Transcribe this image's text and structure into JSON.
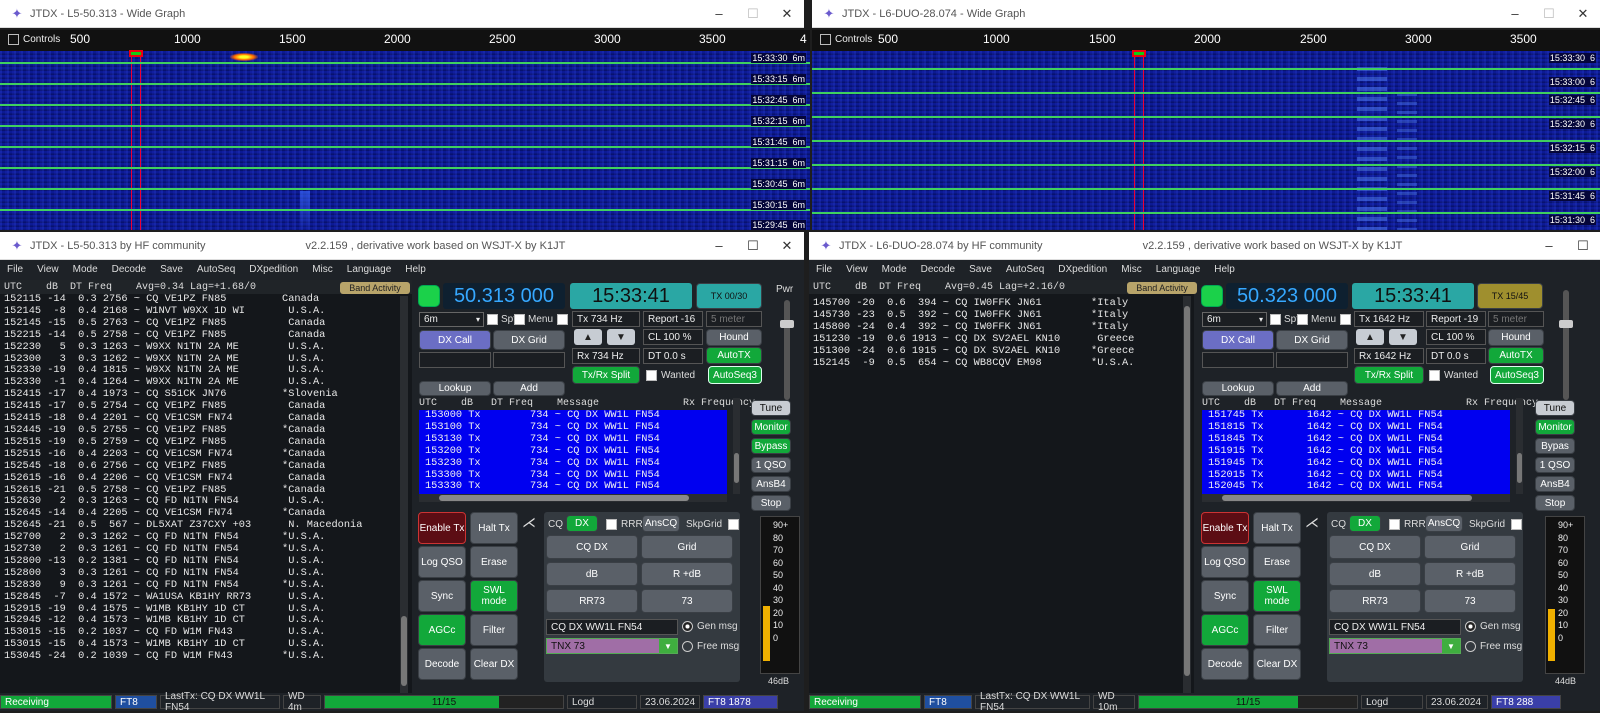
{
  "left_graph": {
    "title": "JTDX - L5-50.313 - Wide Graph",
    "controls_label": "Controls",
    "ticks": [
      "500",
      "1000",
      "1500",
      "2000",
      "2500",
      "3000",
      "3500",
      "4"
    ],
    "times": [
      "15:33:30",
      "15:33:15",
      "15:32:45",
      "15:32:15",
      "15:31:45",
      "15:31:15",
      "15:30:45",
      "15:30:15",
      "15:29:45"
    ],
    "band": "6m"
  },
  "right_graph": {
    "title": "JTDX - L6-DUO-28.074 - Wide Graph",
    "controls_label": "Controls",
    "ticks": [
      "500",
      "1000",
      "1500",
      "2000",
      "2500",
      "3000",
      "3500"
    ],
    "times": [
      "15:33:30",
      "15:33:00",
      "15:32:45",
      "15:32:30",
      "15:32:15",
      "15:32:00",
      "15:31:45",
      "15:31:30"
    ],
    "band": "6"
  },
  "left": {
    "title": "JTDX - L5-50.313  by HF community",
    "version": "v2.2.159 , derivative work based on WSJT-X by K1JT",
    "menu": [
      "File",
      "View",
      "Mode",
      "Decode",
      "Save",
      "AutoSeq",
      "DXpedition",
      "Misc",
      "Language",
      "Help"
    ],
    "decode_header": "UTC    dB  DT Freq    Avg=0.34 Lag=+1.68/0",
    "band_activity": "Band Activity",
    "decodes": "152115 -14  0.3 2756 ~ CQ VE1PZ FN85         Canada\n152145  -8  0.4 2168 ~ W1NVT W9XX 1D WI       U.S.A.\n152145 -15  0.5 2763 ~ CQ VE1PZ FN85          Canada\n152215 -14  0.5 2758 ~ CQ VE1PZ FN85          Canada\n152230   5  0.3 1263 ~ W9XX N1TN 2A ME        U.S.A.\n152300   3  0.3 1262 ~ W9XX N1TN 2A ME        U.S.A.\n152330 -19  0.4 1815 ~ W9XX N1TN 2A ME        U.S.A.\n152330  -1  0.4 1264 ~ W9XX N1TN 2A ME        U.S.A.\n152415 -17  0.4 1973 ~ CQ S51CK JN76         *Slovenia\n152415 -17  0.5 2754 ~ CQ VE1PZ FN85          Canada\n152415 -18  0.4 2201 ~ CQ VE1CSM FN74         Canada\n152445 -19  0.5 2755 ~ CQ VE1PZ FN85         *Canada\n152515 -19  0.5 2759 ~ CQ VE1PZ FN85          Canada\n152515 -16  0.4 2203 ~ CQ VE1CSM FN74        *Canada\n152545 -18  0.6 2756 ~ CQ VE1PZ FN85         *Canada\n152615 -16  0.4 2206 ~ CQ VE1CSM FN74         Canada\n152615 -21  0.5 2758 ~ CQ VE1PZ FN85         *Canada\n152630   2  0.3 1263 ~ CQ FD N1TN FN54        U.S.A.\n152645 -14  0.4 2205 ~ CQ VE1CSM FN74        *Canada\n152645 -21  0.5  567 ~ DL5XAT Z37CXY +03      N. Macedonia\n152700   2  0.3 1262 ~ CQ FD N1TN FN54       *U.S.A.\n152730   2  0.3 1261 ~ CQ FD N1TN FN54       *U.S.A.\n152800 -13  0.2 1381 ~ CQ FD N1TN FN54        U.S.A.\n152800   3  0.3 1261 ~ CQ FD N1TN FN54        U.S.A.\n152830   9  0.3 1261 ~ CQ FD N1TN FN54       *U.S.A.\n152845  -7  0.4 1572 ~ WA1USA KB1HY RR73      U.S.A.\n152915 -19  0.4 1575 ~ W1MB KB1HY 1D CT       U.S.A.\n152945 -12  0.4 1573 ~ W1MB KB1HY 1D CT       U.S.A.\n153015 -15  0.2 1037 ~ CQ FD W1M FN43         U.S.A.\n153015 -15  0.4 1573 ~ W1MB KB1HY 1D CT       U.S.A.\n153045 -24  0.2 1039 ~ CQ FD W1M FN43        *U.S.A.",
    "freq": "50.313 000",
    "clock": "15:33:41",
    "tx_counter": "TX 00/30",
    "pwr": "Pwr",
    "band": "6m",
    "spt": "Spt",
    "menu_chk": "Menu",
    "tx_hz": "Tx  734  Hz",
    "rx_hz": "Rx  734  Hz",
    "report": "Report -16",
    "meter": "5 meter",
    "cl": "CL  100 %",
    "dt": "DT 0.0 s",
    "hound": "Hound",
    "autotx": "AutoTX",
    "autoseq": "AutoSeq3",
    "dxcall": "DX Call",
    "dxgrid": "DX Grid",
    "txrxsplit": "Tx/Rx Split",
    "wanted": "Wanted",
    "lookup": "Lookup",
    "add": "Add",
    "tx_header": "UTC    dB   DT Freq    Message              Rx Frequency",
    "tx_rows": "153000 Tx        734 ~ CQ DX WW1L FN54\n153100 Tx        734 ~ CQ DX WW1L FN54\n153130 Tx        734 ~ CQ DX WW1L FN54\n153200 Tx        734 ~ CQ DX WW1L FN54\n153230 Tx        734 ~ CQ DX WW1L FN54\n153300 Tx        734 ~ CQ DX WW1L FN54\n153330 Tx        734 ~ CQ DX WW1L FN54",
    "tune": "Tune",
    "monitor": "Monitor",
    "bypass": "Bypass",
    "oneqso": "1 QSO",
    "ansb4": "AnsB4",
    "stop": "Stop",
    "enabletx": "Enable Tx",
    "halttx": "Halt Tx",
    "logqso": "Log QSO",
    "erase": "Erase",
    "sync": "Sync",
    "swl": "SWL mode",
    "agcc": "AGCc",
    "filter": "Filter",
    "decode": "Decode",
    "cleardx": "Clear DX",
    "cq": "CQ",
    "dx": "DX",
    "rrr": "RRR",
    "anscq": "AnsCQ",
    "skpgrid": "SkpGrid",
    "cqdx": "CQ DX",
    "grid": "Grid",
    "db": "dB",
    "rdb": "R +dB",
    "rr73": "RR73",
    "b73": "73",
    "genmsg_text": "CQ DX WW1L FN54",
    "genmsg": "Gen msg",
    "tnx": "TNX 73",
    "freemsg": "Free msg",
    "meter_scale": [
      "90+",
      "80",
      "70",
      "60",
      "50",
      "40",
      "30",
      "20",
      "10",
      "0"
    ],
    "meter_db": "46dB",
    "meter_level": 0.42,
    "status": {
      "state": "Receiving",
      "mode": "FT8",
      "lasttx": "LastTx: CQ DX WW1L FN54",
      "wd": "WD 4m",
      "progress": "11/15",
      "logd": "Logd",
      "date": "23.06.2024",
      "mode2": "FT8  1878",
      "progress_frac": 0.73
    }
  },
  "right": {
    "title": "JTDX - L6-DUO-28.074  by HF community",
    "version": "v2.2.159 , derivative work based on WSJT-X by K1JT",
    "menu": [
      "File",
      "View",
      "Mode",
      "Decode",
      "Save",
      "AutoSeq",
      "DXpedition",
      "Misc",
      "Language",
      "Help"
    ],
    "decode_header": "UTC    dB  DT Freq    Avg=0.45 Lag=+2.16/0",
    "band_activity": "Band Activity",
    "decodes": "145700 -20  0.6  394 ~ CQ IW0FFK JN61        *Italy\n145730 -23  0.5  392 ~ CQ IW0FFK JN61        *Italy\n145800 -24  0.4  392 ~ CQ IW0FFK JN61        *Italy\n151230 -19  0.6 1913 ~ CQ DX SV2AEL KN10      Greece\n151300 -24  0.6 1915 ~ CQ DX SV2AEL KN10     *Greece\n152145  -9  0.5  654 ~ CQ WB8CQV EM98        *U.S.A.",
    "freq": "50.323 000",
    "clock": "15:33:41",
    "tx_counter": "TX 15/45",
    "band": "6m",
    "spt": "Spt",
    "menu_chk": "Menu",
    "tx_hz": "Tx  1642  Hz",
    "rx_hz": "Rx  1642  Hz",
    "report": "Report -19",
    "meter": "5 meter",
    "cl": "CL  100 %",
    "dt": "DT 0.0 s",
    "hound": "Hound",
    "autotx": "AutoTX",
    "autoseq": "AutoSeq3",
    "dxcall": "DX Call",
    "dxgrid": "DX Grid",
    "txrxsplit": "Tx/Rx Split",
    "wanted": "Wanted",
    "lookup": "Lookup",
    "add": "Add",
    "tx_header": "UTC    dB   DT Freq    Message              Rx Frequency",
    "tx_rows": "151745 Tx       1642 ~ CQ DX WW1L FN54\n151815 Tx       1642 ~ CQ DX WW1L FN54\n151845 Tx       1642 ~ CQ DX WW1L FN54\n151915 Tx       1642 ~ CQ DX WW1L FN54\n151945 Tx       1642 ~ CQ DX WW1L FN54\n152015 Tx       1642 ~ CQ DX WW1L FN54\n152045 Tx       1642 ~ CQ DX WW1L FN54",
    "tune": "Tune",
    "monitor": "Monitor",
    "bypass": "Bypas",
    "oneqso": "1 QSO",
    "ansb4": "AnsB4",
    "stop": "Stop",
    "enabletx": "Enable Tx",
    "halttx": "Halt Tx",
    "logqso": "Log QSO",
    "erase": "Erase",
    "sync": "Sync",
    "swl": "SWL mode",
    "agcc": "AGCc",
    "filter": "Filter",
    "decode": "Decode",
    "cleardx": "Clear DX",
    "cq": "CQ",
    "dx": "DX",
    "rrr": "RRR",
    "anscq": "AnsCQ",
    "skpgrid": "SkpGrid",
    "cqdx": "CQ DX",
    "grid": "Grid",
    "db": "dB",
    "rdb": "R +dB",
    "rr73": "RR73",
    "b73": "73",
    "genmsg_text": "CQ DX WW1L FN54",
    "genmsg": "Gen msg",
    "tnx": "TNX 73",
    "freemsg": "Free msg",
    "meter_scale": [
      "90+",
      "80",
      "70",
      "60",
      "50",
      "40",
      "30",
      "20",
      "10",
      "0"
    ],
    "meter_db": "44dB",
    "meter_level": 0.4,
    "status": {
      "state": "Receiving",
      "mode": "FT8",
      "lasttx": "LastTx: CQ DX WW1L FN54",
      "wd": "WD 10m",
      "progress": "11/15",
      "logd": "Logd",
      "date": "23.06.2024",
      "mode2": "FT8  288",
      "progress_frac": 0.73
    }
  }
}
